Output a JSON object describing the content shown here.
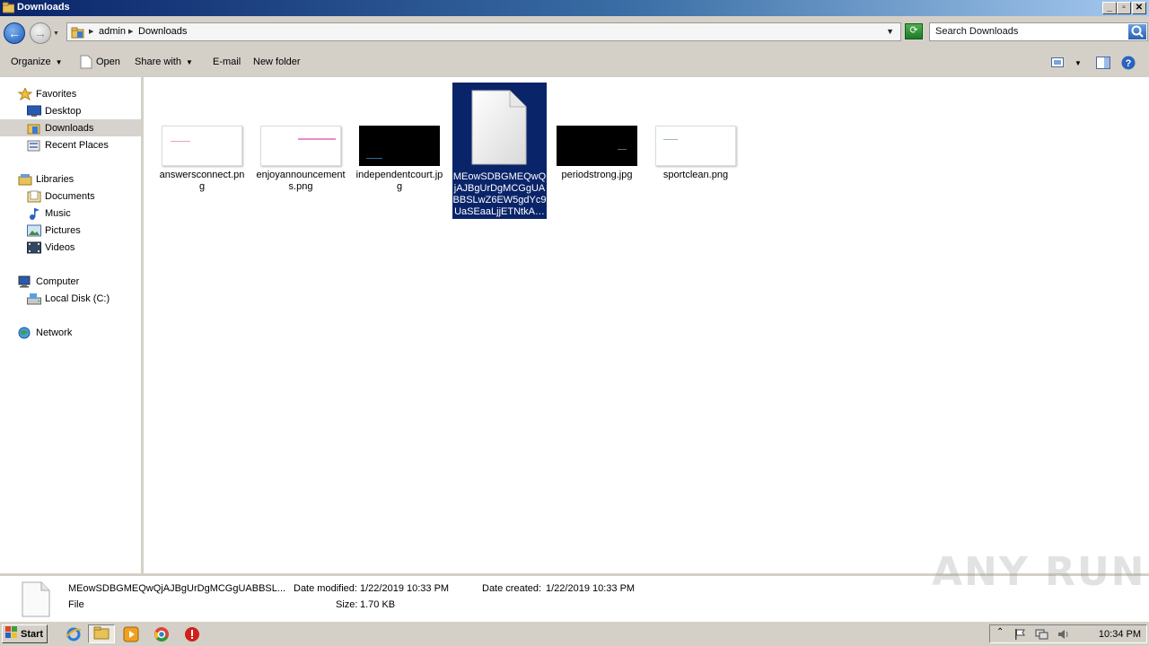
{
  "window": {
    "title": "Downloads"
  },
  "address": {
    "crumbs": [
      "admin",
      "Downloads"
    ],
    "search_placeholder": "Search Downloads"
  },
  "toolbar": {
    "organize": "Organize",
    "open": "Open",
    "share_with": "Share with",
    "email": "E-mail",
    "new_folder": "New folder"
  },
  "nav": {
    "favorites": "Favorites",
    "desktop": "Desktop",
    "downloads": "Downloads",
    "recent_places": "Recent Places",
    "libraries": "Libraries",
    "documents": "Documents",
    "music": "Music",
    "pictures": "Pictures",
    "videos": "Videos",
    "computer": "Computer",
    "local_disk": "Local Disk (C:)",
    "network": "Network"
  },
  "files": [
    {
      "name": "answersconnect.png",
      "thumb": "light"
    },
    {
      "name": "enjoyannouncements.png",
      "thumb": "light"
    },
    {
      "name": "independentcourt.jpg",
      "thumb": "dark"
    },
    {
      "name": "MEowSDBGMEQwQjAJBgUrDgMCGgUABBSLwZ6EW5gdYc9UaSEaaLjjETNtkA…",
      "thumb": "document",
      "selected": true
    },
    {
      "name": "periodstrong.jpg",
      "thumb": "dark"
    },
    {
      "name": "sportclean.png",
      "thumb": "light"
    }
  ],
  "details": {
    "filename": "MEowSDBGMEQwQjAJBgUrDgMCGgUABBSL...",
    "type": "File",
    "date_modified_label": "Date modified:",
    "date_modified": "1/22/2019 10:33 PM",
    "date_created_label": "Date created:",
    "date_created": "1/22/2019 10:33 PM",
    "size_label": "Size:",
    "size": "1.70 KB"
  },
  "watermark": "ANY RUN",
  "taskbar": {
    "start": "Start",
    "clock": "10:34 PM"
  },
  "colors": {
    "selection": "#0a246a",
    "title_start": "#0a246a",
    "title_end": "#a6caf0"
  }
}
